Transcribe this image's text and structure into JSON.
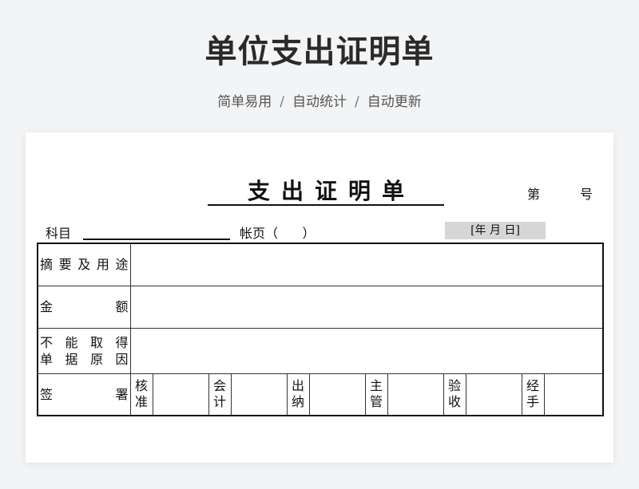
{
  "header": {
    "title": "单位支出证明单",
    "tagline": [
      "简单易用",
      "自动统计",
      "自动更新"
    ],
    "separator": "/"
  },
  "document": {
    "title": "支出证明单",
    "number_label": "第",
    "number_suffix": "号",
    "subject_label": "科目",
    "ledger_label": "帐页（      ）",
    "date_box": "[年 月 日]",
    "rows": {
      "summary_label": "摘要及用途",
      "amount_label": "金 额",
      "no_receipt_line1": "不能取得",
      "no_receipt_line2": "单据原因",
      "signature_label": "签 署"
    },
    "signatures": [
      {
        "line1": "核",
        "line2": "准"
      },
      {
        "line1": "会",
        "line2": "计"
      },
      {
        "line1": "出",
        "line2": "纳"
      },
      {
        "line1": "主",
        "line2": "管"
      },
      {
        "line1": "验",
        "line2": "收"
      },
      {
        "line1": "经",
        "line2": "手"
      }
    ]
  }
}
